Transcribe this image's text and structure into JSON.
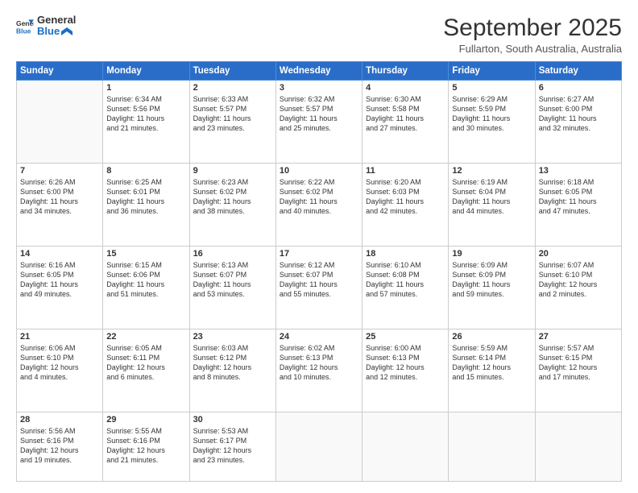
{
  "logo": {
    "line1": "General",
    "line2": "Blue"
  },
  "title": "September 2025",
  "location": "Fullarton, South Australia, Australia",
  "headers": [
    "Sunday",
    "Monday",
    "Tuesday",
    "Wednesday",
    "Thursday",
    "Friday",
    "Saturday"
  ],
  "weeks": [
    [
      {
        "day": "",
        "info": ""
      },
      {
        "day": "1",
        "info": "Sunrise: 6:34 AM\nSunset: 5:56 PM\nDaylight: 11 hours\nand 21 minutes."
      },
      {
        "day": "2",
        "info": "Sunrise: 6:33 AM\nSunset: 5:57 PM\nDaylight: 11 hours\nand 23 minutes."
      },
      {
        "day": "3",
        "info": "Sunrise: 6:32 AM\nSunset: 5:57 PM\nDaylight: 11 hours\nand 25 minutes."
      },
      {
        "day": "4",
        "info": "Sunrise: 6:30 AM\nSunset: 5:58 PM\nDaylight: 11 hours\nand 27 minutes."
      },
      {
        "day": "5",
        "info": "Sunrise: 6:29 AM\nSunset: 5:59 PM\nDaylight: 11 hours\nand 30 minutes."
      },
      {
        "day": "6",
        "info": "Sunrise: 6:27 AM\nSunset: 6:00 PM\nDaylight: 11 hours\nand 32 minutes."
      }
    ],
    [
      {
        "day": "7",
        "info": "Sunrise: 6:26 AM\nSunset: 6:00 PM\nDaylight: 11 hours\nand 34 minutes."
      },
      {
        "day": "8",
        "info": "Sunrise: 6:25 AM\nSunset: 6:01 PM\nDaylight: 11 hours\nand 36 minutes."
      },
      {
        "day": "9",
        "info": "Sunrise: 6:23 AM\nSunset: 6:02 PM\nDaylight: 11 hours\nand 38 minutes."
      },
      {
        "day": "10",
        "info": "Sunrise: 6:22 AM\nSunset: 6:02 PM\nDaylight: 11 hours\nand 40 minutes."
      },
      {
        "day": "11",
        "info": "Sunrise: 6:20 AM\nSunset: 6:03 PM\nDaylight: 11 hours\nand 42 minutes."
      },
      {
        "day": "12",
        "info": "Sunrise: 6:19 AM\nSunset: 6:04 PM\nDaylight: 11 hours\nand 44 minutes."
      },
      {
        "day": "13",
        "info": "Sunrise: 6:18 AM\nSunset: 6:05 PM\nDaylight: 11 hours\nand 47 minutes."
      }
    ],
    [
      {
        "day": "14",
        "info": "Sunrise: 6:16 AM\nSunset: 6:05 PM\nDaylight: 11 hours\nand 49 minutes."
      },
      {
        "day": "15",
        "info": "Sunrise: 6:15 AM\nSunset: 6:06 PM\nDaylight: 11 hours\nand 51 minutes."
      },
      {
        "day": "16",
        "info": "Sunrise: 6:13 AM\nSunset: 6:07 PM\nDaylight: 11 hours\nand 53 minutes."
      },
      {
        "day": "17",
        "info": "Sunrise: 6:12 AM\nSunset: 6:07 PM\nDaylight: 11 hours\nand 55 minutes."
      },
      {
        "day": "18",
        "info": "Sunrise: 6:10 AM\nSunset: 6:08 PM\nDaylight: 11 hours\nand 57 minutes."
      },
      {
        "day": "19",
        "info": "Sunrise: 6:09 AM\nSunset: 6:09 PM\nDaylight: 11 hours\nand 59 minutes."
      },
      {
        "day": "20",
        "info": "Sunrise: 6:07 AM\nSunset: 6:10 PM\nDaylight: 12 hours\nand 2 minutes."
      }
    ],
    [
      {
        "day": "21",
        "info": "Sunrise: 6:06 AM\nSunset: 6:10 PM\nDaylight: 12 hours\nand 4 minutes."
      },
      {
        "day": "22",
        "info": "Sunrise: 6:05 AM\nSunset: 6:11 PM\nDaylight: 12 hours\nand 6 minutes."
      },
      {
        "day": "23",
        "info": "Sunrise: 6:03 AM\nSunset: 6:12 PM\nDaylight: 12 hours\nand 8 minutes."
      },
      {
        "day": "24",
        "info": "Sunrise: 6:02 AM\nSunset: 6:13 PM\nDaylight: 12 hours\nand 10 minutes."
      },
      {
        "day": "25",
        "info": "Sunrise: 6:00 AM\nSunset: 6:13 PM\nDaylight: 12 hours\nand 12 minutes."
      },
      {
        "day": "26",
        "info": "Sunrise: 5:59 AM\nSunset: 6:14 PM\nDaylight: 12 hours\nand 15 minutes."
      },
      {
        "day": "27",
        "info": "Sunrise: 5:57 AM\nSunset: 6:15 PM\nDaylight: 12 hours\nand 17 minutes."
      }
    ],
    [
      {
        "day": "28",
        "info": "Sunrise: 5:56 AM\nSunset: 6:16 PM\nDaylight: 12 hours\nand 19 minutes."
      },
      {
        "day": "29",
        "info": "Sunrise: 5:55 AM\nSunset: 6:16 PM\nDaylight: 12 hours\nand 21 minutes."
      },
      {
        "day": "30",
        "info": "Sunrise: 5:53 AM\nSunset: 6:17 PM\nDaylight: 12 hours\nand 23 minutes."
      },
      {
        "day": "",
        "info": ""
      },
      {
        "day": "",
        "info": ""
      },
      {
        "day": "",
        "info": ""
      },
      {
        "day": "",
        "info": ""
      }
    ]
  ]
}
